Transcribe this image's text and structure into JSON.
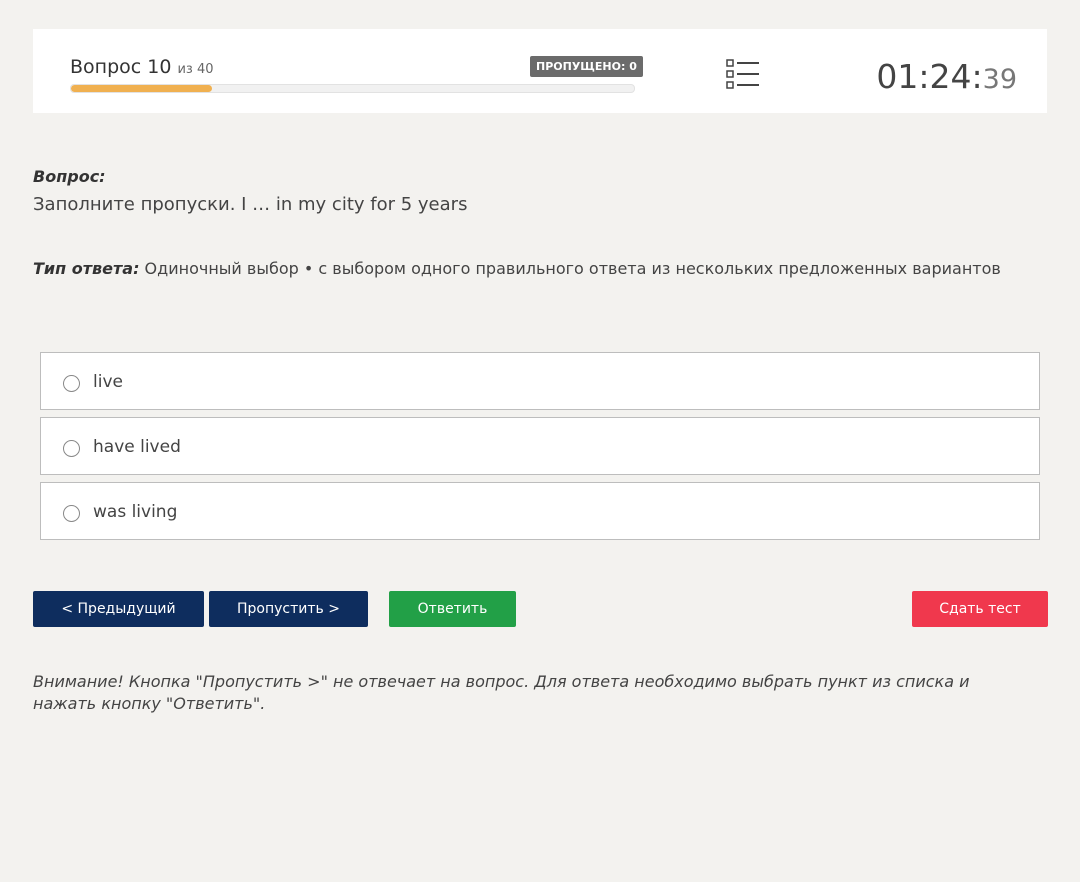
{
  "header": {
    "question_prefix": "Вопрос 10",
    "question_of": "из 40",
    "skipped_badge": "ПРОПУЩЕНО: 0",
    "progress_fraction": 0.25,
    "timer_main": "01:24:",
    "timer_seconds": "39"
  },
  "question": {
    "label": "Вопрос:",
    "text": "Заполните пропуски. I … in my city for 5 years"
  },
  "answer_type": {
    "label": "Тип ответа:",
    "value": " Одиночный выбор • с выбором одного правильного ответа из нескольких предложенных вариантов"
  },
  "options": [
    {
      "label": "live"
    },
    {
      "label": "have lived"
    },
    {
      "label": "was living"
    }
  ],
  "buttons": {
    "prev": "< Предыдущий",
    "skip": "Пропустить >",
    "answer": "Ответить",
    "submit": "Сдать тест"
  },
  "warning": "Внимание! Кнопка \"Пропустить >\" не отвечает на вопрос. Для ответа необходимо выбрать пункт из списка и нажать кнопку \"Ответить\".",
  "colors": {
    "progress": "#f0b050",
    "primary": "#0e2d5e",
    "answer": "#22a047",
    "submit": "#f0384d"
  },
  "icons": {
    "question_list": "list-icon"
  }
}
